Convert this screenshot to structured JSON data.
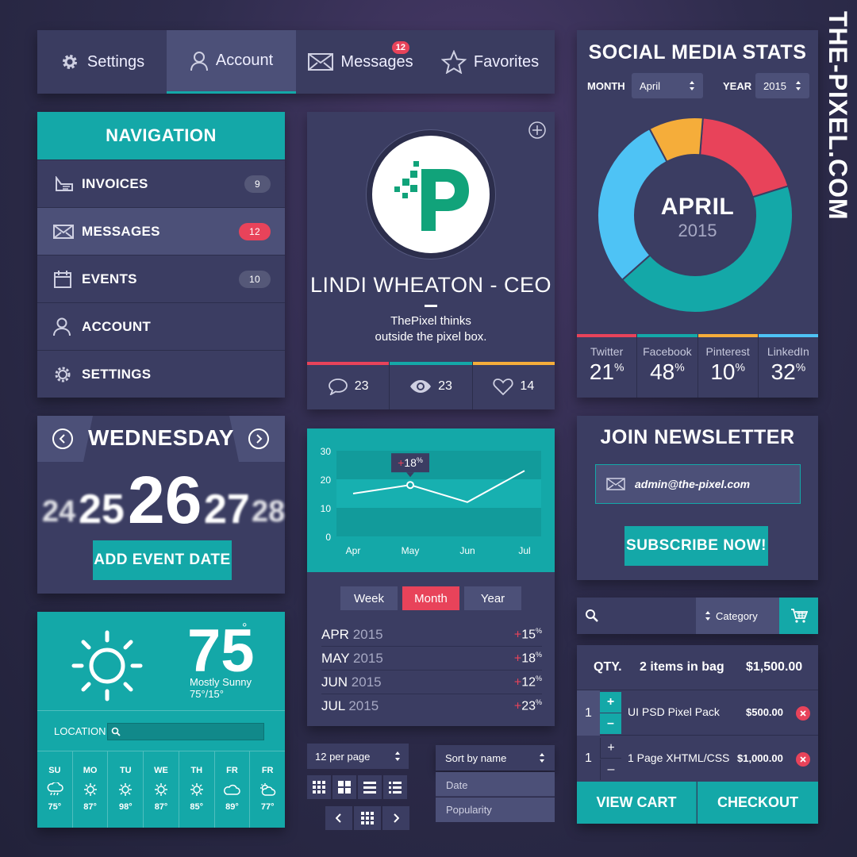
{
  "tabs": [
    {
      "label": "Settings",
      "icon": "gear-icon"
    },
    {
      "label": "Account",
      "icon": "user-icon"
    },
    {
      "label": "Messages",
      "icon": "envelope-icon",
      "badge": "12"
    },
    {
      "label": "Favorites",
      "icon": "star-icon"
    }
  ],
  "watermark": "THE-PIXEL.COM",
  "navigation": {
    "title": "NAVIGATION",
    "items": [
      {
        "label": "INVOICES",
        "count": "9"
      },
      {
        "label": "MESSAGES",
        "count": "12"
      },
      {
        "label": "EVENTS",
        "count": "10"
      },
      {
        "label": "ACCOUNT",
        "count": ""
      },
      {
        "label": "SETTINGS",
        "count": ""
      }
    ]
  },
  "profile": {
    "name": "LINDI WHEATON - CEO",
    "tagline1": "ThePixel thinks",
    "tagline2": "outside the pixel box.",
    "comments": "23",
    "views": "23",
    "likes": "14",
    "colors": [
      "#e8435a",
      "#14a8a8",
      "#f5ad3a"
    ]
  },
  "social": {
    "title": "SOCIAL MEDIA STATS",
    "month_label": "MONTH",
    "month_value": "April",
    "year_label": "YEAR",
    "year_value": "2015",
    "center_month": "APRIL",
    "center_year": "2015",
    "stats": [
      {
        "name": "Twitter",
        "value": "21",
        "unit": "%",
        "color": "#e8435a"
      },
      {
        "name": "Facebook",
        "value": "48",
        "unit": "%",
        "color": "#14a8a8"
      },
      {
        "name": "Pinterest",
        "value": "10",
        "unit": "%",
        "color": "#f5ad3a"
      },
      {
        "name": "LinkedIn",
        "value": "32",
        "unit": "%",
        "color": "#4ec3f5"
      }
    ]
  },
  "calendar": {
    "day": "WEDNESDAY",
    "dates": [
      "24",
      "25",
      "26",
      "27",
      "28"
    ],
    "button": "ADD EVENT DATE"
  },
  "weather": {
    "temp": "75",
    "degree": "°",
    "condition": "Mostly Sunny",
    "range": "75°/15°",
    "location_label": "LOCATION",
    "days": [
      {
        "d": "SU",
        "t": "75°",
        "icon": "rain-cloud-icon"
      },
      {
        "d": "MO",
        "t": "87°",
        "icon": "sun-icon"
      },
      {
        "d": "TU",
        "t": "98°",
        "icon": "sun-icon"
      },
      {
        "d": "WE",
        "t": "87°",
        "icon": "sun-icon"
      },
      {
        "d": "TH",
        "t": "85°",
        "icon": "sun-icon"
      },
      {
        "d": "FR",
        "t": "89°",
        "icon": "cloud-icon"
      },
      {
        "d": "FR",
        "t": "77°",
        "icon": "partly-cloudy-icon"
      }
    ]
  },
  "chart_data": {
    "type": "line",
    "categories": [
      "Apr",
      "May",
      "Jun",
      "Jul"
    ],
    "values": [
      15,
      18,
      12,
      23
    ],
    "ylim": [
      0,
      30
    ],
    "yticks": [
      "30",
      "20",
      "10",
      "0"
    ],
    "annotation": {
      "sign": "+",
      "value": "18",
      "unit": "%",
      "at": "May"
    },
    "xlabel": "",
    "ylabel": ""
  },
  "period": {
    "buttons": [
      "Week",
      "Month",
      "Year"
    ],
    "active": "Month"
  },
  "growth": [
    {
      "m": "APR",
      "y": "2015",
      "sign": "+",
      "v": "15",
      "u": "%"
    },
    {
      "m": "MAY",
      "y": "2015",
      "sign": "+",
      "v": "18",
      "u": "%"
    },
    {
      "m": "JUN",
      "y": "2015",
      "sign": "+",
      "v": "12",
      "u": "%"
    },
    {
      "m": "JUL",
      "y": "2015",
      "sign": "+",
      "v": "23",
      "u": "%"
    }
  ],
  "paging": {
    "per_page": "12 per page",
    "sort": "Sort by name",
    "sort_options": [
      "Date",
      "Popularity"
    ]
  },
  "newsletter": {
    "title": "JOIN NEWSLETTER",
    "email": "admin@the-pixel.com",
    "button": "SUBSCRIBE NOW!"
  },
  "shop": {
    "category": "Category",
    "qty_label": "QTY.",
    "summary": "2 items in bag",
    "total": "$1,500.00",
    "items": [
      {
        "qty": "1",
        "name": "UI PSD Pixel Pack",
        "price": "$500.00"
      },
      {
        "qty": "1",
        "name": "1 Page XHTML/CSS",
        "price": "$1,000.00"
      }
    ],
    "view_cart": "VIEW CART",
    "checkout": "CHECKOUT"
  },
  "colors": {
    "teal": "#14a8a8",
    "red": "#e8435a",
    "orange": "#f5ad3a",
    "blue": "#4ec3f5",
    "panel": "#3b3d62"
  }
}
